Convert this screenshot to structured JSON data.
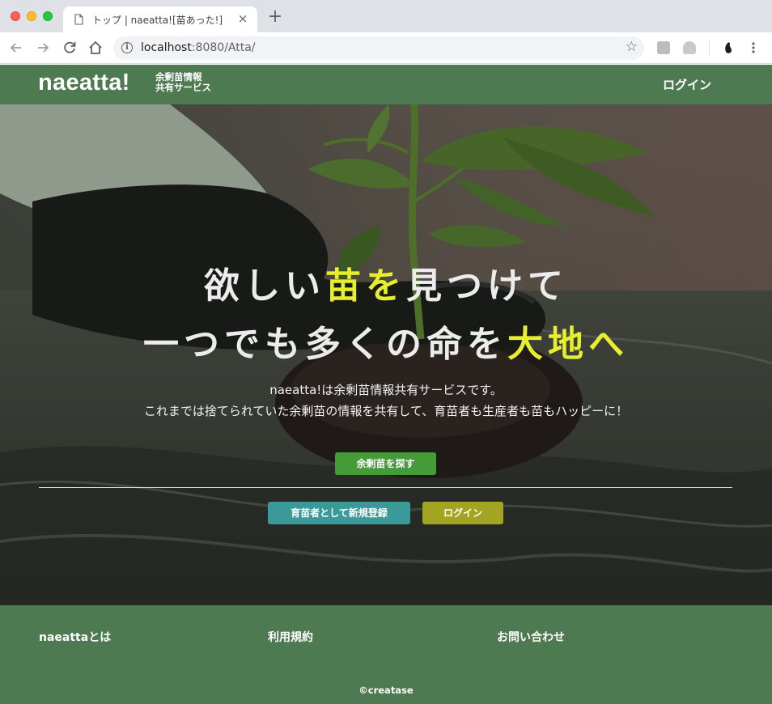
{
  "browser": {
    "tab_title": "トップ | naeatta![苗あった!]",
    "tab_close": "×",
    "new_tab": "+",
    "url_host": "localhost",
    "url_rest": ":8080/Atta/",
    "star": "☆"
  },
  "header": {
    "logo": "naeatta!",
    "tagline_line1": "余剰苗情報",
    "tagline_line2": "共有サービス",
    "login": "ログイン"
  },
  "hero": {
    "headline1_a": "欲しい",
    "headline1_b": "苗を",
    "headline1_c": "見つけて",
    "headline2_a": "一つでも多くの命を",
    "headline2_b": "大地へ",
    "desc1": "naeatta!は余剰苗情報共有サービスです。",
    "desc2": "これまでは捨てられていた余剰苗の情報を共有して、育苗者も生産者も苗もハッピーに！",
    "search_button": "余剰苗を探す",
    "register_button": "育苗者として新規登録",
    "login_button": "ログイン"
  },
  "footer": {
    "about": "naeattaとは",
    "terms": "利用規約",
    "contact": "お問い合わせ",
    "copyright": "©creatase"
  },
  "colors": {
    "header_green": "#4d7a51",
    "accent_yellow": "#e6ee2e",
    "search_button": "#449b38",
    "register_button": "#3a9a9a",
    "login_button": "#a3a421"
  }
}
